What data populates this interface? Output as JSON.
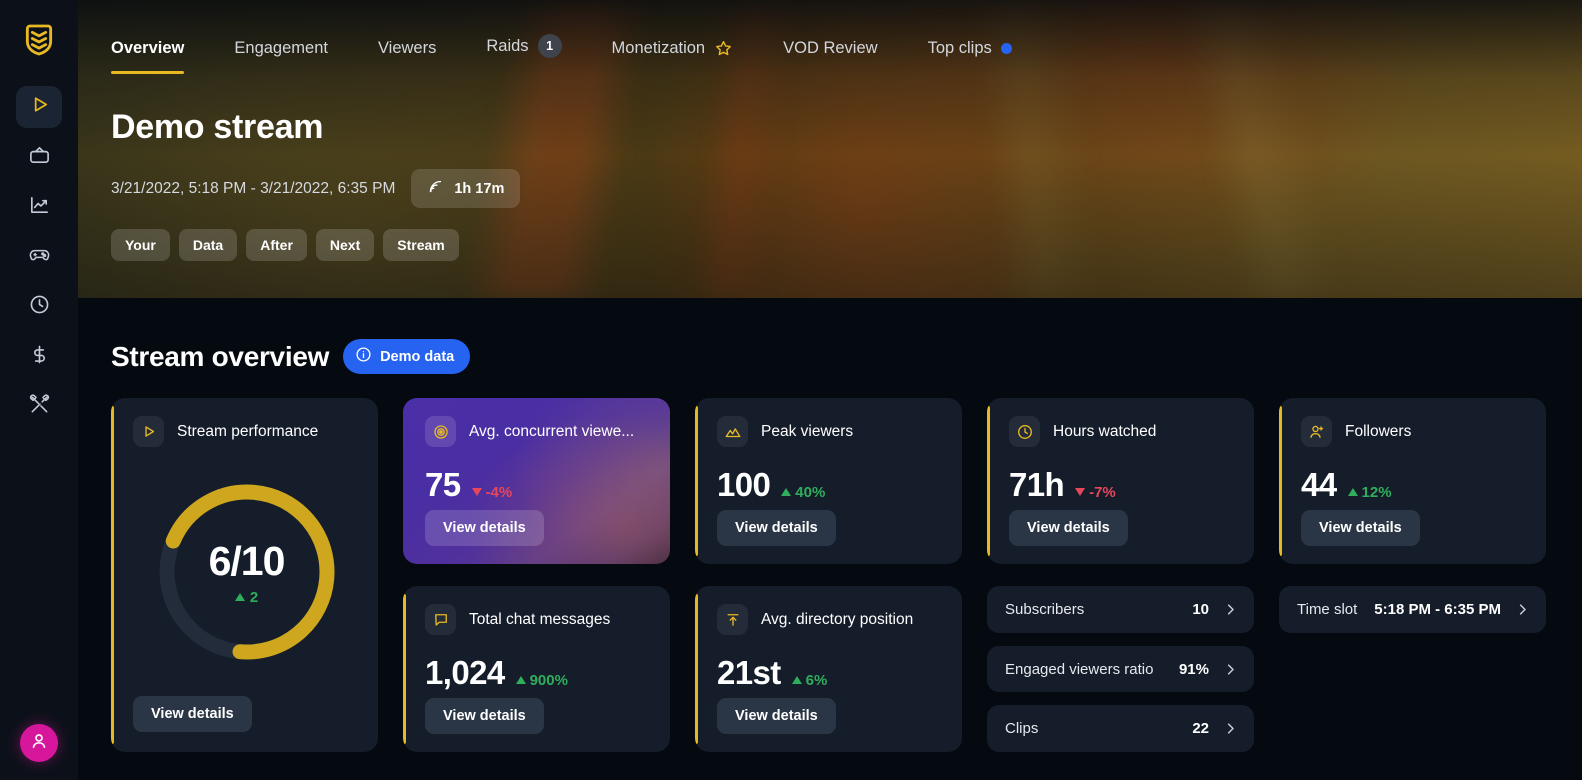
{
  "sidebar": {
    "logo_icon": "shield-badge-logo",
    "items": [
      {
        "icon": "play-icon",
        "name": "streams",
        "active": true
      },
      {
        "icon": "tv-icon",
        "name": "channel",
        "active": false
      },
      {
        "icon": "trending-icon",
        "name": "analytics",
        "active": false
      },
      {
        "icon": "gamepad-icon",
        "name": "games",
        "active": false
      },
      {
        "icon": "clock-icon",
        "name": "schedule",
        "active": false
      },
      {
        "icon": "dollar-icon",
        "name": "revenue",
        "active": false
      },
      {
        "icon": "tools-icon",
        "name": "tools",
        "active": false
      }
    ],
    "avatar_icon": "user-avatar-icon"
  },
  "tabs": [
    {
      "label": "Overview",
      "active": true,
      "badge": null,
      "marker": null
    },
    {
      "label": "Engagement",
      "active": false,
      "badge": null,
      "marker": null
    },
    {
      "label": "Viewers",
      "active": false,
      "badge": null,
      "marker": null
    },
    {
      "label": "Raids",
      "active": false,
      "badge": "1",
      "marker": null
    },
    {
      "label": "Monetization",
      "active": false,
      "badge": null,
      "marker": "star"
    },
    {
      "label": "VOD Review",
      "active": false,
      "badge": null,
      "marker": null
    },
    {
      "label": "Top clips",
      "active": false,
      "badge": null,
      "marker": "dot"
    }
  ],
  "hero": {
    "title": "Demo stream",
    "dates": "3/21/2022, 5:18 PM - 3/21/2022, 6:35 PM",
    "duration": "1h 17m",
    "duration_icon": "broadcast-icon",
    "tags": [
      "Your",
      "Data",
      "After",
      "Next",
      "Stream"
    ]
  },
  "section": {
    "title": "Stream overview",
    "badge_label": "Demo data",
    "badge_icon": "info-icon",
    "badge_color": "#2563f0"
  },
  "colors": {
    "accent": "#e8b923",
    "positive": "#2fae5c",
    "negative": "#e8465c",
    "card_bg": "#151d2a",
    "page_bg": "#050910",
    "blue": "#2563f0",
    "avatar": "#d6179b"
  },
  "gauge_card": {
    "title": "Stream performance",
    "icon": "play-icon",
    "value": "6/10",
    "delta": "2",
    "delta_dir": "up",
    "percent": 60,
    "button": "View details"
  },
  "cards": [
    {
      "title": "Avg. concurrent viewe...",
      "icon": "eye-target-icon",
      "value": "75",
      "delta": "-4%",
      "delta_dir": "down",
      "button": "View details",
      "style": "purple"
    },
    {
      "title": "Peak viewers",
      "icon": "peak-mountain-icon",
      "value": "100",
      "delta": "40%",
      "delta_dir": "up",
      "button": "View details",
      "style": "default"
    },
    {
      "title": "Hours watched",
      "icon": "clock-icon",
      "value": "71h",
      "delta": "-7%",
      "delta_dir": "down",
      "button": "View details",
      "style": "default"
    },
    {
      "title": "Followers",
      "icon": "user-plus-icon",
      "value": "44",
      "delta": "12%",
      "delta_dir": "up",
      "button": "View details",
      "style": "default"
    },
    {
      "title": "Total chat messages",
      "icon": "chat-bubble-icon",
      "value": "1,024",
      "delta": "900%",
      "delta_dir": "up",
      "button": "View details",
      "style": "default"
    },
    {
      "title": "Avg. directory position",
      "icon": "arrow-up-bar-icon",
      "value": "21st",
      "delta": "6%",
      "delta_dir": "up",
      "button": "View details",
      "style": "default"
    }
  ],
  "list_rows": [
    {
      "label": "Subscribers",
      "value": "10",
      "chevron": "chevron-right-icon"
    },
    {
      "label": "Engaged viewers ratio",
      "value": "91%",
      "chevron": "chevron-right-icon"
    },
    {
      "label": "Clips",
      "value": "22",
      "chevron": "chevron-right-icon"
    }
  ],
  "time_slot": {
    "label": "Time slot",
    "value": "5:18 PM - 6:35 PM",
    "chevron": "chevron-right-icon"
  }
}
